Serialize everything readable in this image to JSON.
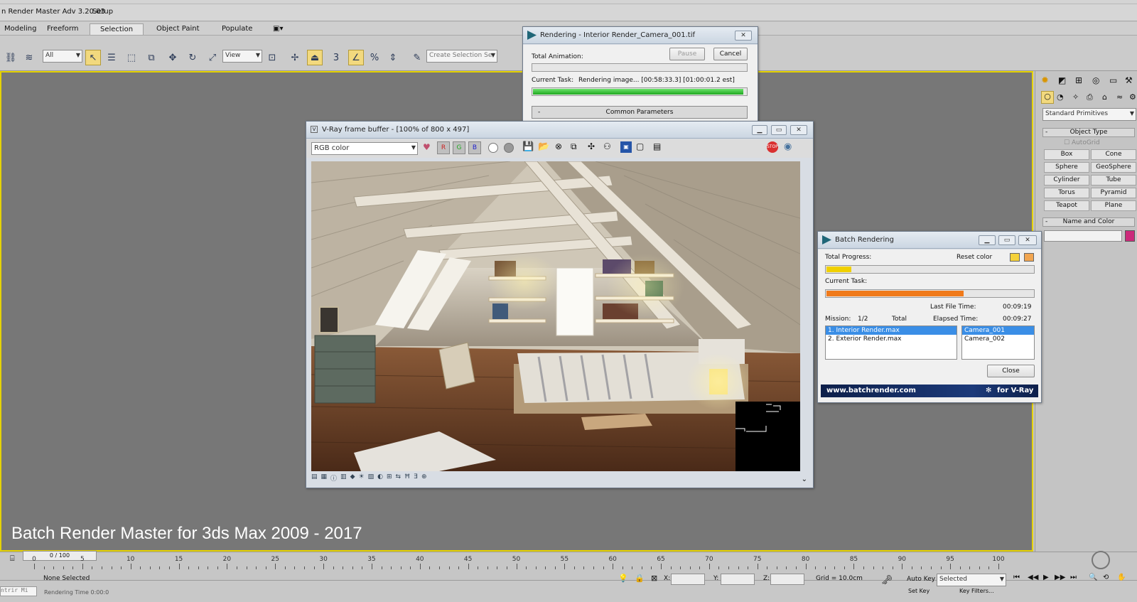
{
  "app": {
    "title_prefix": "n Render Master Adv 3.20.03",
    "setup_label": "Setup"
  },
  "ribbon": {
    "tabs": [
      "Modeling",
      "Freeform",
      "Selection",
      "Object Paint",
      "Populate"
    ],
    "active_tab": "Selection"
  },
  "toolbar": {
    "filter_value": "All",
    "refcoord_value": "View",
    "selection_set_placeholder": "Create Selection Se"
  },
  "rendering_dialog": {
    "title": "Rendering - Interior Render_Camera_001.tif",
    "pause_label": "Pause",
    "cancel_label": "Cancel",
    "total_animation_label": "Total Animation:",
    "current_task_label": "Current Task:",
    "current_task_value": "Rendering image... [00:58:33.3] [01:00:01.2 est]",
    "current_task_progress": 0.98,
    "common_params_label": "Common Parameters",
    "rollout_minus": "-"
  },
  "vfb": {
    "title": "V-Ray frame buffer - [100% of 800 x 497]",
    "channel_value": "RGB color"
  },
  "batch": {
    "title": "Batch Rendering",
    "total_progress_label": "Total Progress:",
    "reset_color_label": "Reset color",
    "total_progress": 0.12,
    "current_task_label": "Current Task:",
    "current_task_progress": 0.66,
    "last_file_time_label": "Last File Time:",
    "last_file_time": "00:09:19",
    "mission_label": "Mission:",
    "mission_value": "1/2",
    "total_label": "Total",
    "elapsed_label": "Elapsed Time:",
    "elapsed_value": "00:09:27",
    "files": [
      "1.  Interior Render.max",
      "2.  Exterior Render.max"
    ],
    "cameras": [
      "Camera_001",
      "Camera_002"
    ],
    "close_label": "Close",
    "footer_url": "www.batchrender.com",
    "footer_tag": "for V-Ray",
    "colors": {
      "progress_yellow": "#f0d000",
      "progress_orange": "#f07a1a",
      "swatch1": "#f5d23a",
      "swatch2": "#f2a650"
    }
  },
  "command_panel": {
    "category_value": "Standard Primitives",
    "object_type_label": "Object Type",
    "autogrid_label": "AutoGrid",
    "primitives": [
      "Box",
      "Cone",
      "Sphere",
      "GeoSphere",
      "Cylinder",
      "Tube",
      "Torus",
      "Pyramid",
      "Teapot",
      "Plane"
    ],
    "name_color_label": "Name and Color",
    "object_color": "#cc2a7a"
  },
  "viewport": {
    "caption": "Batch Render Master for 3ds Max 2009 - 2017",
    "border_color": "#e5d200"
  },
  "timeline": {
    "frame_value": "0 / 100",
    "tick_labels": [
      "0",
      "5",
      "10",
      "15",
      "20",
      "25",
      "30",
      "35",
      "40",
      "45",
      "50",
      "55",
      "60",
      "65",
      "70",
      "75",
      "80",
      "85",
      "90",
      "95",
      "100"
    ]
  },
  "status": {
    "selection_text": "None Selected",
    "x_label": "X:",
    "y_label": "Y:",
    "z_label": "Z:",
    "grid_text": "Grid = 10.0cm",
    "autokey_label": "Auto Key",
    "autokey_value": "Selected",
    "setkey_label": "Set Key",
    "keyfilters_label": "Key Filters...",
    "left_snippet": "ntrir Mi",
    "render_time_snippet": "Rendering Time 0:00:0"
  }
}
